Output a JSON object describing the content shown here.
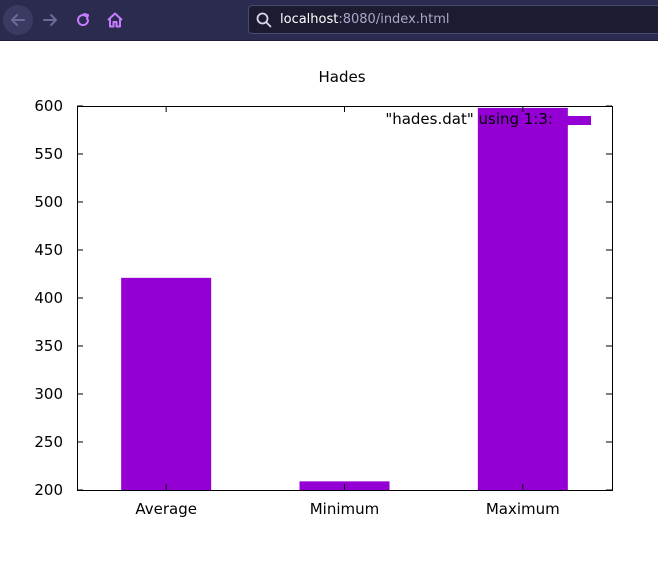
{
  "browser": {
    "url_host": "localhost",
    "url_rest": ":8080/index.html",
    "accent": "#2b2a4f"
  },
  "chart_data": {
    "type": "bar",
    "title": "Hades",
    "categories": [
      "Average",
      "Minimum",
      "Maximum"
    ],
    "series": [
      {
        "name": "\"hades.dat\" using 1:3:",
        "values": [
          421,
          209,
          598
        ],
        "color": "#9400d3"
      }
    ],
    "ylim": [
      200,
      600
    ],
    "yticks": [
      200,
      250,
      300,
      350,
      400,
      450,
      500,
      550,
      600
    ],
    "legend": "top-right",
    "grid": false
  }
}
